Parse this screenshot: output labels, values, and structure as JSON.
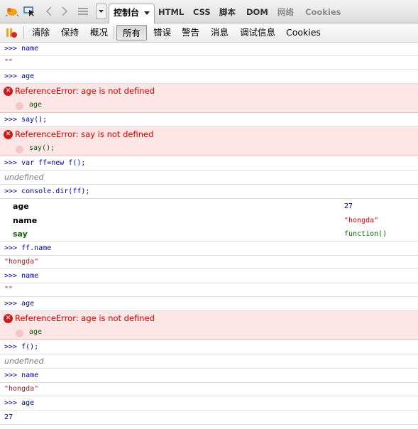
{
  "toolbar": {
    "tabs": [
      "控制台",
      "HTML",
      "CSS",
      "脚本",
      "DOM",
      "网络",
      "Cookies"
    ]
  },
  "filters": [
    "清除",
    "保持",
    "概况",
    "所有",
    "错误",
    "警告",
    "消息",
    "调试信息",
    "Cookies"
  ],
  "log": {
    "c1": ">>> name",
    "s1": "\"\"",
    "c2": ">>> age",
    "e2": "ReferenceError: age is not defined",
    "e2src": "age",
    "c3": ">>> say();",
    "e3": "ReferenceError: say is not defined",
    "e3src": "say();",
    "c4": ">>> var ff=new f();",
    "u4": "undefined",
    "c5": ">>> console.dir(ff);",
    "dir": {
      "k1": "age",
      "v1": "27",
      "k2": "name",
      "v2": "\"hongda\"",
      "k3": "say",
      "v3": "function()"
    },
    "c6": ">>> ff.name",
    "s6": "\"hongda\"",
    "c7": ">>> name",
    "s7": "\"\"",
    "c8": ">>> age",
    "e8": "ReferenceError: age is not defined",
    "e8src": "age",
    "c9": ">>> f();",
    "u9": "undefined",
    "c10": ">>> name",
    "s10": "\"hongda\"",
    "c11": ">>> age",
    "n11": "27"
  }
}
